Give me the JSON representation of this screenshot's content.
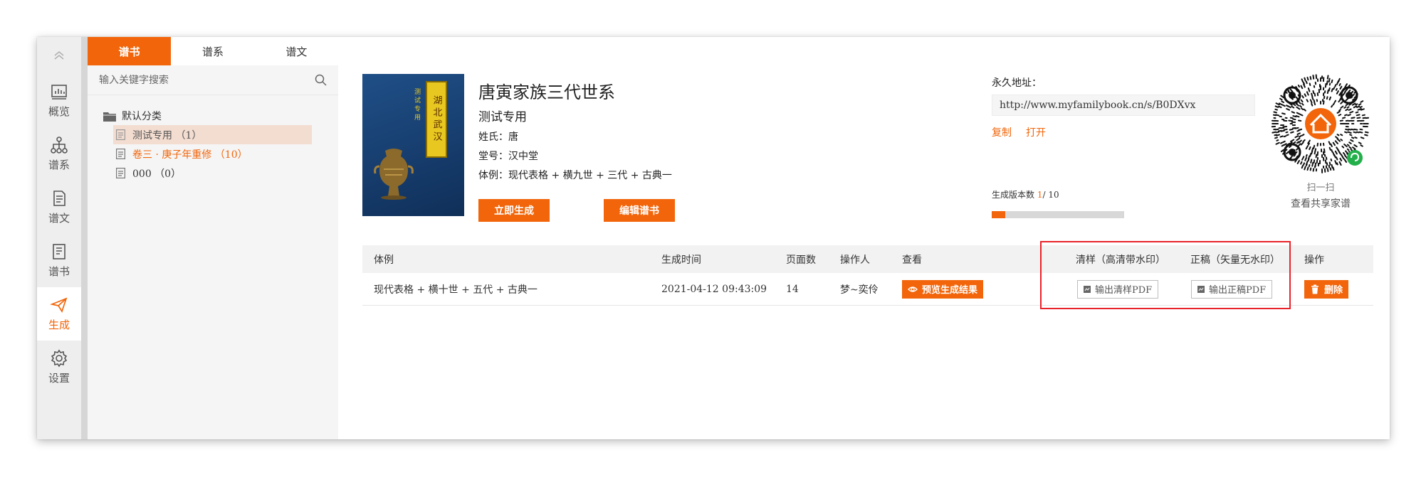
{
  "nav": {
    "items": [
      {
        "label": "概览",
        "icon": "chart-icon"
      },
      {
        "label": "谱系",
        "icon": "tree-icon"
      },
      {
        "label": "谱文",
        "icon": "document-icon"
      },
      {
        "label": "谱书",
        "icon": "book-icon"
      },
      {
        "label": "生成",
        "icon": "send-icon",
        "active": true
      },
      {
        "label": "设置",
        "icon": "gear-icon"
      }
    ]
  },
  "tree": {
    "tabs": [
      "谱书",
      "谱系",
      "谱文"
    ],
    "search_placeholder": "输入关键字搜索",
    "folder": "默认分类",
    "items": [
      "测试专用 （1）",
      "卷三 · 庚子年重修 （10）",
      "000 （0）"
    ]
  },
  "book": {
    "cover_title": "湖北武汉",
    "cover_subtitle": "测试专用",
    "title": "唐寅家族三代世系",
    "subtitle": "测试专用",
    "surname": "姓氏：唐",
    "hall": "堂号：汉中堂",
    "style": "体例：现代表格 + 横九世 + 三代 + 古典一",
    "generate_button": "立即生成",
    "edit_button": "编辑谱书"
  },
  "permalink": {
    "label": "永久地址：",
    "url": "http://www.myfamilybook.cn/s/B0DXvx",
    "copy": "复制",
    "open": "打开",
    "version_label": "生成版本数",
    "version_current": "1",
    "version_total": "/ 10",
    "progress_fraction": 0.1
  },
  "qr": {
    "line1": "扫一扫",
    "line2": "查看共享家谱"
  },
  "table": {
    "headers": {
      "style": "体例",
      "time": "生成时间",
      "pages": "页面数",
      "operator": "操作人",
      "view": "查看",
      "draft": "清样（高清带水印）",
      "final": "正稿（矢量无水印）",
      "action": "操作"
    },
    "rows": [
      {
        "style": "现代表格 + 横十世 + 五代 + 古典一",
        "time": "2021-04-12 09:43:09",
        "pages": "14",
        "operator": "梦~奕伶",
        "view": "预览生成结果",
        "draft": "输出清样PDF",
        "final": "输出正稿PDF",
        "action": "删除"
      }
    ]
  },
  "colors": {
    "accent": "#f2650a",
    "highlight_box": "#e8232a"
  }
}
